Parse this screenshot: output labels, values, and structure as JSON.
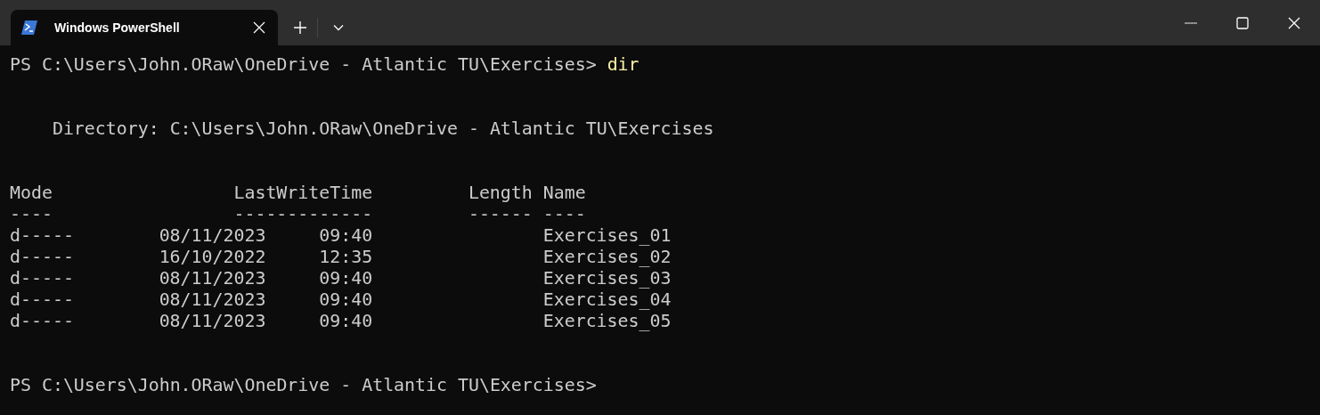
{
  "tabs": [
    {
      "title": "Windows PowerShell",
      "selected": true
    }
  ],
  "terminal": [
    {
      "kind": "prompt",
      "prompt": "PS C:\\Users\\John.ORaw\\OneDrive - Atlantic TU\\Exercises> ",
      "command": "dir"
    },
    {
      "kind": "blank"
    },
    {
      "kind": "blank"
    },
    {
      "kind": "text",
      "text": "    Directory: C:\\Users\\John.ORaw\\OneDrive - Atlantic TU\\Exercises"
    },
    {
      "kind": "blank"
    },
    {
      "kind": "blank"
    },
    {
      "kind": "listing",
      "columns": [
        "Mode",
        "LastWriteTime",
        "Length",
        "Name"
      ],
      "underlines": [
        "----",
        "-------------",
        "------",
        "----"
      ],
      "rows": [
        {
          "mode": "d-----",
          "date": "08/11/2023",
          "time": "09:40",
          "name": "Exercises_01"
        },
        {
          "mode": "d-----",
          "date": "16/10/2022",
          "time": "12:35",
          "name": "Exercises_02"
        },
        {
          "mode": "d-----",
          "date": "08/11/2023",
          "time": "09:40",
          "name": "Exercises_03"
        },
        {
          "mode": "d-----",
          "date": "08/11/2023",
          "time": "09:40",
          "name": "Exercises_04"
        },
        {
          "mode": "d-----",
          "date": "08/11/2023",
          "time": "09:40",
          "name": "Exercises_05"
        }
      ]
    },
    {
      "kind": "blank"
    },
    {
      "kind": "blank"
    },
    {
      "kind": "prompt",
      "prompt": "PS C:\\Users\\John.ORaw\\OneDrive - Atlantic TU\\Exercises>"
    }
  ]
}
